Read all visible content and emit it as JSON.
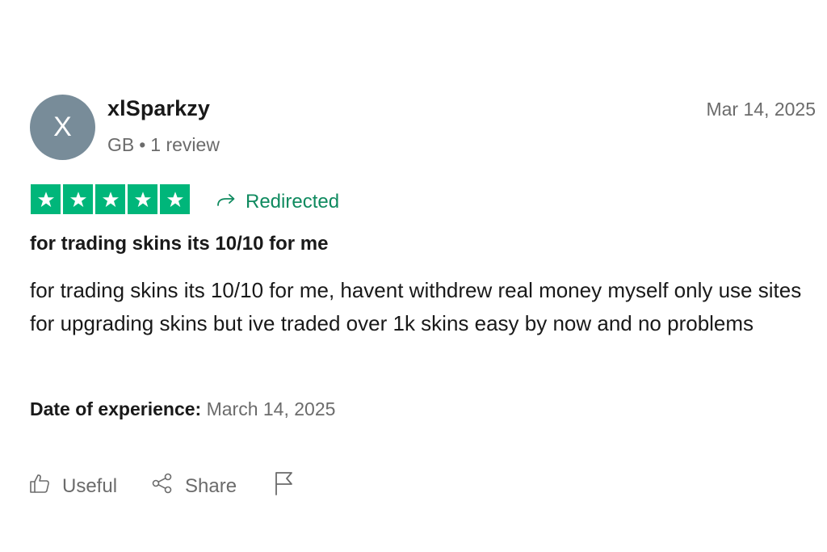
{
  "review": {
    "avatar_initial": "X",
    "username": "xlSparkzy",
    "country": "GB",
    "separator": "•",
    "review_count": "1 review",
    "date": "Mar 14, 2025",
    "rating": 5,
    "rating_color": "#00b67a",
    "redirected_label": "Redirected",
    "title": "for trading skins its 10/10 for me",
    "body": "for trading skins its 10/10 for me, havent withdrew real money myself only use sites for upgrading skins but ive traded over 1k skins easy by now and no problems",
    "experience_label": "Date of experience:",
    "experience_date": "March 14, 2025"
  },
  "actions": {
    "useful_label": "Useful",
    "share_label": "Share",
    "useful_icon": "thumbs-up-icon",
    "share_icon": "share-icon",
    "report_icon": "flag-icon"
  }
}
